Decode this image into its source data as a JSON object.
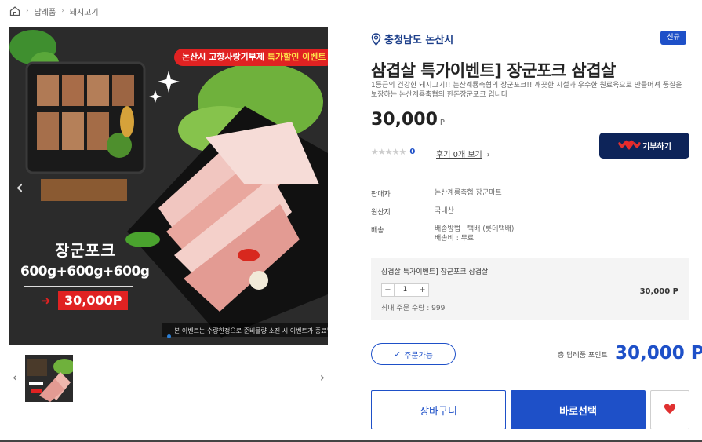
{
  "breadcrumb": {
    "home_icon": "home-icon",
    "items": [
      "답례품",
      "돼지고기"
    ]
  },
  "hero": {
    "banner_prefix": "논산시 고향사랑기부제",
    "banner_highlight": "특가할인 이벤트",
    "brand": "장군포크",
    "combo": "600g+600g+600g",
    "price_tag": "30,000P",
    "notice": "본 이벤트는 수량한정으로 준비물량 소진 시 이벤트가 종료됩니다."
  },
  "product": {
    "region": "충청남도 논산시",
    "badge": "신규",
    "title": "삼겹살 특가이벤트] 장군포크 삼겹살",
    "description": "1등급의 건강한 돼지고기!! 논산계룡축협의 장군포크!! 깨끗한 시설과 우수한 원료육으로 만들어져 품질을 보장하는 논산계룡축협의 한돈장군포크 입니다",
    "price": "30,000",
    "price_unit": "P",
    "rating_count": "0",
    "review_link": "후기 0개 보기",
    "donate_label": "기부하기"
  },
  "info": [
    {
      "key": "판매자",
      "value": "논산계룡축협 장군마트"
    },
    {
      "key": "원산지",
      "value": "국내산"
    },
    {
      "key": "배송",
      "value": "배송방법 : 택배 (롯데택배)",
      "value2": "배송비 : 무료"
    }
  ],
  "option": {
    "name": "삼겹살 특가이벤트] 장군포크 삼겹살",
    "minus": "−",
    "quantity": "1",
    "plus": "+",
    "price": "30,000 P",
    "max_order": "최대 주문 수량 : 999"
  },
  "summary": {
    "orderable": "주문가능",
    "total_label": "총 답례품 포인트",
    "total_value": "30,000 P"
  },
  "actions": {
    "cart": "장바구니",
    "buy": "바로선택"
  },
  "colors": {
    "primary": "#1e50c8",
    "navy": "#0d2459",
    "red": "#e02222"
  }
}
